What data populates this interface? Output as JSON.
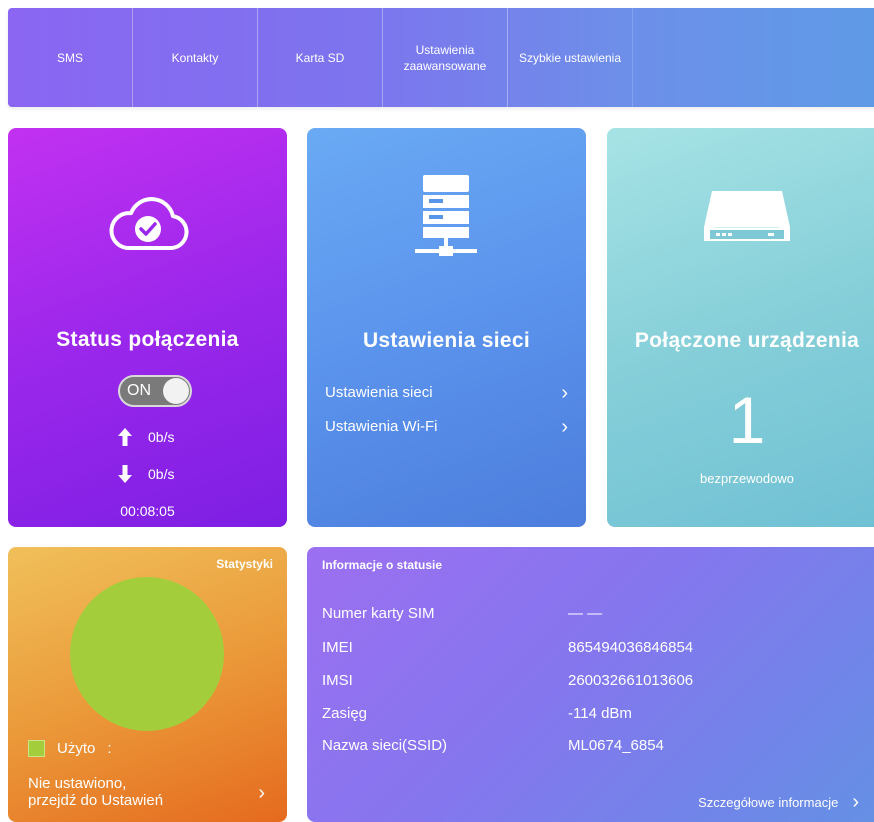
{
  "nav": {
    "items": [
      {
        "label": "SMS"
      },
      {
        "label": "Kontakty"
      },
      {
        "label": "Karta SD"
      },
      {
        "label": "Ustawienia zaawansowane"
      },
      {
        "label": "Szybkie ustawienia"
      }
    ]
  },
  "status_card": {
    "title": "Status połączenia",
    "toggle_label": "ON",
    "upload_rate": "0b/s",
    "download_rate": "0b/s",
    "uptime": "00:08:05",
    "icon": "cloud-check-icon"
  },
  "network_card": {
    "title": "Ustawienia sieci",
    "icon": "server-network-icon",
    "links": [
      {
        "label": "Ustawienia sieci"
      },
      {
        "label": "Ustawienia Wi-Fi"
      }
    ]
  },
  "devices_card": {
    "title": "Połączone urządzenia",
    "icon": "router-icon",
    "count": "1",
    "subtitle": "bezprzewodowo"
  },
  "stats_card": {
    "title": "Statystyki",
    "legend_label": "Użyto",
    "legend_value": ":",
    "used_fraction": 1.0,
    "link_line1": "Nie ustawiono,",
    "link_line2": "przejdź do Ustawień"
  },
  "info_card": {
    "title": "Informacje o statusie",
    "rows": [
      {
        "label": "Numer karty SIM",
        "value": "— —"
      },
      {
        "label": "IMEI",
        "value": "865494036846854"
      },
      {
        "label": "IMSI",
        "value": "260032661013606"
      },
      {
        "label": "Zasięg",
        "value": "-114 dBm"
      },
      {
        "label": "Nazwa sieci(SSID)",
        "value": "ML0674_6854"
      }
    ],
    "more_label": "Szczegółowe informacje"
  },
  "colors": {
    "status": "#9a27eb",
    "network": "#5a93ec",
    "devices": "#86cfd9",
    "stats": "#eb9a3a",
    "info": "#8576ee",
    "pie_used": "#a4cd3c"
  }
}
